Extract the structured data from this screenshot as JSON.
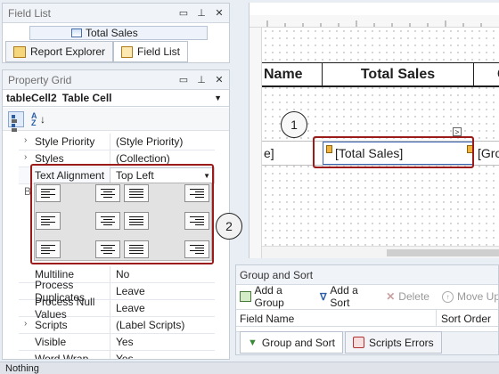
{
  "field_list": {
    "title": "Field List",
    "item": "Total Sales"
  },
  "tabs": {
    "report_explorer": "Report Explorer",
    "field_list": "Field List"
  },
  "property_grid": {
    "title": "Property Grid",
    "object_name": "tableCell2",
    "object_type": "Table Cell",
    "rows": [
      {
        "name": "Style Priority",
        "value": "(Style Priority)",
        "expandable": true
      },
      {
        "name": "Styles",
        "value": "(Collection)",
        "expandable": true
      },
      {
        "name": "Text Alignment",
        "value": "Top Left",
        "expandable": false
      },
      {
        "name": "Multiline",
        "value": "No",
        "expandable": false
      },
      {
        "name": "Process Duplicates",
        "value": "Leave",
        "expandable": false
      },
      {
        "name": "Process Null Values",
        "value": "Leave",
        "expandable": false
      },
      {
        "name": "Scripts",
        "value": "(Label Scripts)",
        "expandable": true
      },
      {
        "name": "Visible",
        "value": "Yes",
        "expandable": false
      },
      {
        "name": "Word Wrap",
        "value": "Yes",
        "expandable": false
      }
    ],
    "partial_label": "B"
  },
  "designer": {
    "headers": [
      "Name",
      "Total Sales",
      "G"
    ],
    "cells": [
      "e]",
      "[Total Sales]",
      "[Gross"
    ],
    "smart_tag": ">"
  },
  "callouts": [
    "1",
    "2"
  ],
  "group_sort": {
    "title": "Group and Sort",
    "toolbar": {
      "add_group": "Add a Group",
      "add_sort": "Add a Sort",
      "delete": "Delete",
      "move_up": "Move Up"
    },
    "columns": [
      "Field Name",
      "Sort Order"
    ]
  },
  "bottom_tabs": {
    "group_sort": "Group and Sort",
    "scripts_errors": "Scripts Errors"
  },
  "status": {
    "text": "Nothing"
  },
  "colors": {
    "callout_border": "#9b1b1b",
    "header_underline": "#1e1e1e",
    "selection_blue": "#3c64b4"
  }
}
